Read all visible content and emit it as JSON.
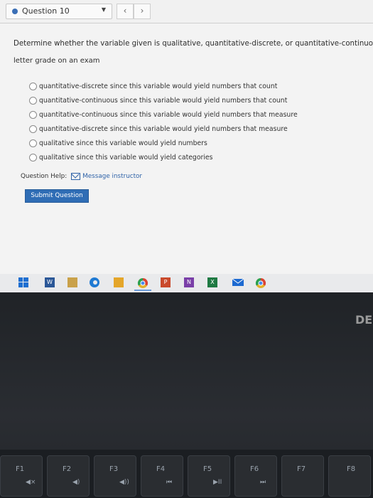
{
  "question_bar": {
    "label": "Question 10",
    "caret": "▼",
    "prev": "‹",
    "next": "›"
  },
  "prompt": "Determine whether the variable given is qualitative, quantitative-discrete, or quantitative-continuous.",
  "subject": "letter grade on an exam",
  "options": [
    "quantitative-discrete since this variable would yield numbers that count",
    "quantitative-continuous since this variable would yield numbers that count",
    "quantitative-continuous since this variable would yield numbers that measure",
    "quantitative-discrete since this variable would yield numbers that measure",
    "qualitative since this variable would yield numbers",
    "qualitative since this variable would yield categories"
  ],
  "help": {
    "label": "Question Help:",
    "link": "Message instructor"
  },
  "submit_label": "Submit Question",
  "taskbar": {
    "windows_icon": "windows-logo-icon",
    "word_label": "W",
    "powerpoint_label": "P",
    "onenote_label": "N",
    "excel_label": "X"
  },
  "keyboard": {
    "brand_text": "DE",
    "fkeys": [
      "F1",
      "F2",
      "F3",
      "F4",
      "F5",
      "F6",
      "F7",
      "F8"
    ],
    "fkey_symbols": [
      "◀×",
      "◀)",
      "◀))",
      "⏮",
      "▶II",
      "⏭",
      "",
      ""
    ]
  },
  "colors": {
    "accent": "#2f6db5",
    "link": "#2f63a8",
    "status_dot": "#3b6fb6"
  }
}
